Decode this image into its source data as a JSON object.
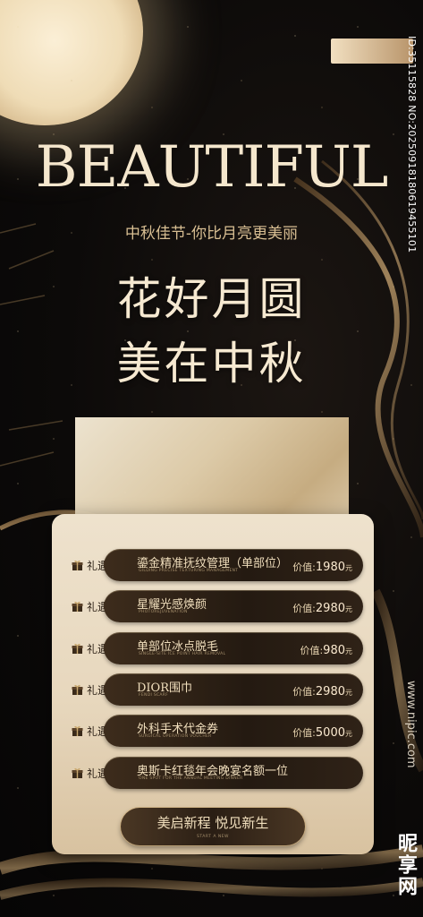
{
  "poster": {
    "title": "BEAUTIFUL",
    "subtitle": "中秋佳节-你比月亮更美丽",
    "headline_1": "花好月圆",
    "headline_2": "美在中秋",
    "side_id": "ID:35115828 NO:20250918180619455101"
  },
  "gifts": [
    {
      "label": "礼遇1.",
      "name": "鎏金精准抚纹管理（单部位）",
      "en": "GILDING PRECISE TEXTURING MANAGEMENT",
      "price_prefix": "价值:",
      "price": "1980",
      "unit": "元"
    },
    {
      "label": "礼遇2.",
      "name": "星耀光感焕颜",
      "en": "PHOTOREJUVENATION",
      "price_prefix": "价值:",
      "price": "2980",
      "unit": "元"
    },
    {
      "label": "礼遇3.",
      "name": "单部位冰点脱毛",
      "en": "SINGLE-SITE ICE POINT HAIR REMOVAL",
      "price_prefix": "价值:",
      "price": "980",
      "unit": "元"
    },
    {
      "label": "礼遇4.",
      "name": "DIOR围巾",
      "en": "FENDI SCARF",
      "price_prefix": "价值:",
      "price": "2980",
      "unit": "元"
    },
    {
      "label": "礼遇5.",
      "name": "外科手术代金券",
      "en": "SURGICAL OPERATION VOUCHER",
      "price_prefix": "价值:",
      "price": "5000",
      "unit": "元"
    },
    {
      "label": "礼遇6.",
      "name": "奥斯卡红毯年会晚宴名额一位",
      "en": "ONE SPOT FOR THE ANNUAL MEETING DINNER",
      "price_prefix": "",
      "price": "",
      "unit": ""
    }
  ],
  "cta": {
    "label": "美启新程 悦见新生",
    "sub": "START A NEW"
  },
  "watermark": {
    "site": "www.nipic.com",
    "brand": "昵享网"
  },
  "colors": {
    "gold": "#d9bf93",
    "cream": "#f5e7cd",
    "dark": "#0b0908"
  }
}
